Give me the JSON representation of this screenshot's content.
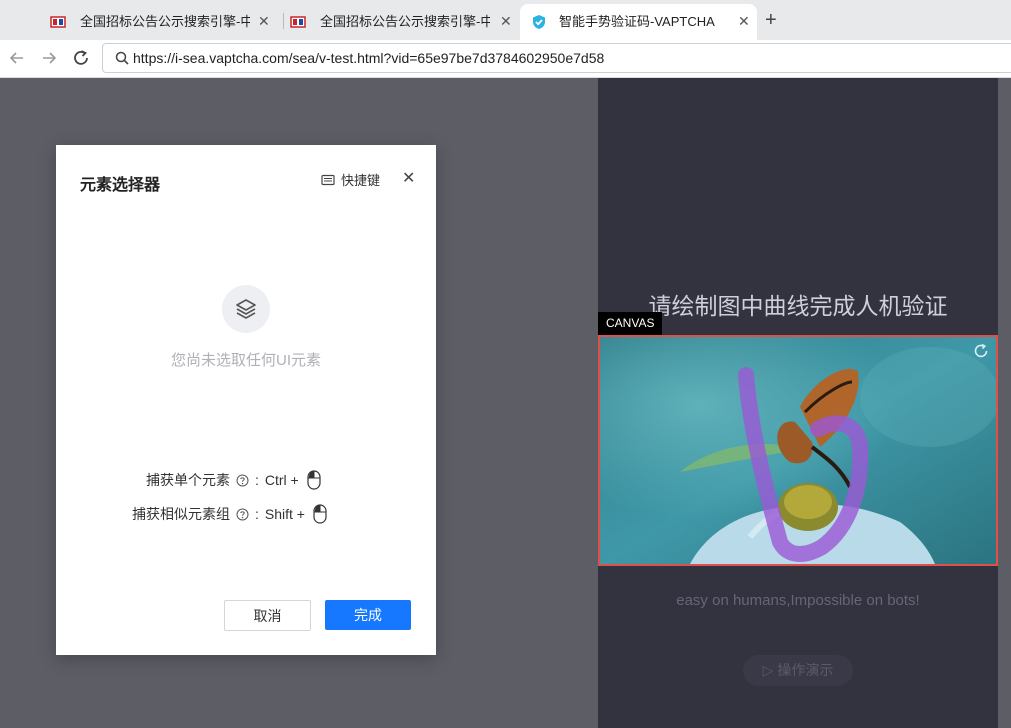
{
  "browser": {
    "tabs": [
      {
        "title": "全国招标公告公示搜索引擎-中国",
        "active": false
      },
      {
        "title": "全国招标公告公示搜索引擎-中国",
        "active": false
      },
      {
        "title": "智能手势验证码-VAPTCHA",
        "active": true
      }
    ],
    "close_glyph": "✕",
    "new_tab_glyph": "+",
    "url": "https://i-sea.vaptcha.com/sea/v-test.html?vid=65e97be7d3784602950e7d58"
  },
  "captcha_page": {
    "title": "请绘制图中曲线完成人机验证",
    "canvas_tag": "CANVAS",
    "slogan": "easy on humans,Impossible on bots!",
    "demo_button": "▷ 操作演示"
  },
  "dialog": {
    "title": "元素选择器",
    "shortcut_label": "快捷键",
    "close_glyph": "✕",
    "empty_text": "您尚未选取任何UI元素",
    "hints": [
      {
        "label": "捕获单个元素",
        "separator": ":",
        "keys": "Ctrl +"
      },
      {
        "label": "捕获相似元素组",
        "separator": ":",
        "keys": "Shift +"
      }
    ],
    "cancel_label": "取消",
    "confirm_label": "完成"
  },
  "colors": {
    "primary_button": "#1677ff",
    "canvas_highlight": "#e0504a",
    "overlay_dark": "#33323f"
  }
}
